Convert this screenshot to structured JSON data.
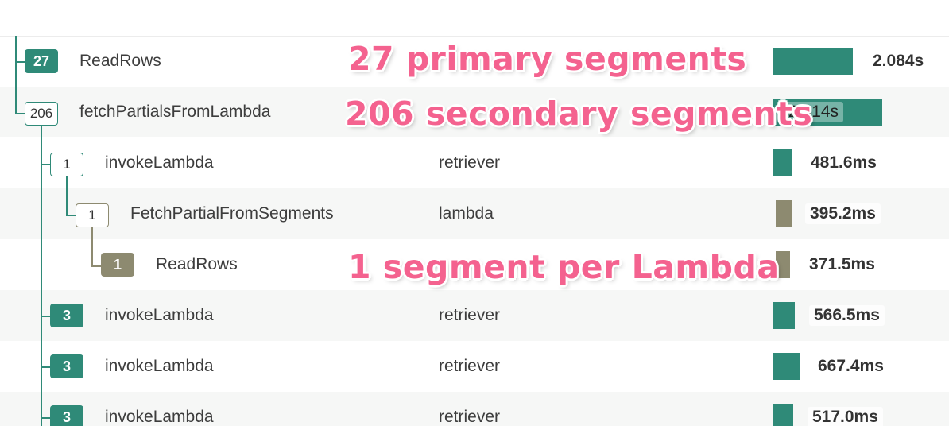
{
  "rows": [
    {
      "count": "27",
      "name": "ReadRows",
      "service": "",
      "duration": "2.084s",
      "duration_ms": 2084
    },
    {
      "count": "206",
      "name": "fetchPartialsFromLambda",
      "service": "",
      "duration": "2.814s",
      "duration_ms": 2814
    },
    {
      "count": "1",
      "name": "invokeLambda",
      "service": "retriever",
      "duration": "481.6ms",
      "duration_ms": 481.6
    },
    {
      "count": "1",
      "name": "FetchPartialFromSegments",
      "service": "lambda",
      "duration": "395.2ms",
      "duration_ms": 395.2
    },
    {
      "count": "1",
      "name": "ReadRows",
      "service": "",
      "duration": "371.5ms",
      "duration_ms": 371.5
    },
    {
      "count": "3",
      "name": "invokeLambda",
      "service": "retriever",
      "duration": "566.5ms",
      "duration_ms": 566.5
    },
    {
      "count": "3",
      "name": "invokeLambda",
      "service": "retriever",
      "duration": "667.4ms",
      "duration_ms": 667.4
    },
    {
      "count": "3",
      "name": "invokeLambda",
      "service": "retriever",
      "duration": "517.0ms",
      "duration_ms": 517.0
    }
  ],
  "annotations": [
    "27 primary segments",
    "206 secondary segments",
    "1 segment per Lambda"
  ],
  "colors": {
    "teal": "#2f8a78",
    "olive": "#8d8a70",
    "annotation_pink": "#f4628f",
    "alt_row": "#f6f7f6"
  }
}
